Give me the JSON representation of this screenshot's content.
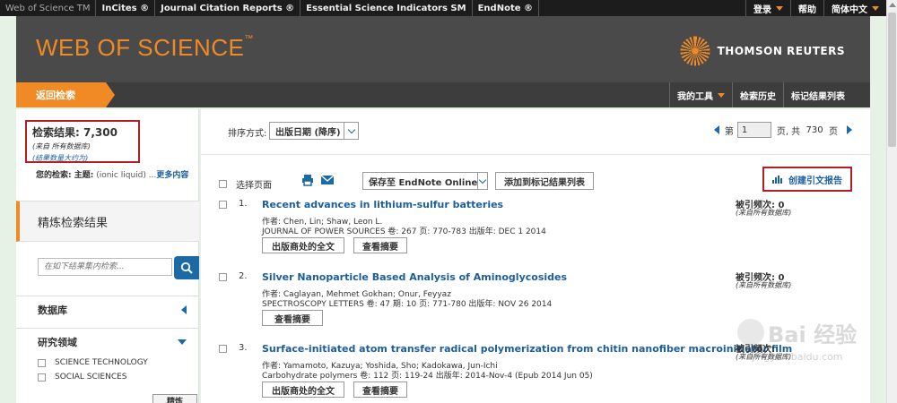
{
  "topbar": {
    "links": [
      "Web of Science TM",
      "InCites ®",
      "Journal Citation Reports ®",
      "Essential Science Indicators SM",
      "EndNote ®"
    ],
    "login": "登录",
    "help": "帮助",
    "language": "简体中文"
  },
  "brand": {
    "logo": "WEB OF SCIENCE",
    "logo_tm": "™",
    "publisher": "THOMSON REUTERS"
  },
  "nav": {
    "back": "返回检索",
    "my_tools": "我的工具",
    "search_history": "检索历史",
    "marked_list": "标记结果列表"
  },
  "sidebar": {
    "results_count": "检索结果: 7,300",
    "from_all": "(来自 所有数据库)",
    "approx": "(结果数量大约为)",
    "query_label": "您的检索: 主题:",
    "query_value": " (ionic liquid) ...",
    "more": "更多内容",
    "refine_title": "精炼检索结果",
    "search_placeholder": "在如下结果集内检索...",
    "database_title": "数据库",
    "research_area_title": "研究领域",
    "facets": [
      "SCIENCE TECHNOLOGY",
      "SOCIAL SCIENCES"
    ],
    "refine_button": "精炼"
  },
  "main": {
    "sort_label": "排序方式:",
    "sort_value": "出版日期 (降序)",
    "pager": {
      "page_label": "第",
      "current": "1",
      "page_suffix": "页, 共",
      "total": "730",
      "pages_unit": "页"
    },
    "select_page": "选择页面",
    "endnote_select": "保存至 EndNote Online",
    "add_marked": "添加到标记结果列表",
    "cite_report": "创建引文报告",
    "records": [
      {
        "num": "1.",
        "title": "Recent advances in lithium-sulfur batteries",
        "authors": "作者: Chen, Lin; Shaw, Leon L.",
        "source": "JOURNAL OF POWER SOURCES  卷: 267  页: 770-783  出版年: DEC 1 2014",
        "btn_fulltext": "出版商处的全文",
        "btn_abstract": "查看摘要",
        "cited": "被引频次: 0",
        "cited_sub": "(来自所有数据库)"
      },
      {
        "num": "2.",
        "title": "Silver Nanoparticle Based Analysis of Aminoglycosides",
        "authors": "作者: Caglayan, Mehmet Gokhan; Onur, Feyyaz",
        "source": "SPECTROSCOPY LETTERS  卷: 47  期: 10  页: 771-780  出版年: NOV 26 2014",
        "btn_abstract": "查看摘要",
        "cited": "被引频次: 0",
        "cited_sub": "(来自所有数据库)"
      },
      {
        "num": "3.",
        "title": "Surface-initiated atom transfer radical polymerization from chitin nanofiber macroinitiator film",
        "authors": "作者: Yamamoto, Kazuya; Yoshida, Sho; Kadokawa, Jun-Ichi",
        "source": "Carbohydrate polymers  卷: 112  页: 119-24  出版年: 2014-Nov-4 (Epub 2014 Jun 05)",
        "btn_fulltext": "出版商处的全文",
        "btn_abstract": "查看摘要",
        "cited": "被引频次:",
        "cited_sub": "(来自所有数据库)"
      }
    ]
  },
  "watermark": {
    "text": "Bai 经验",
    "sub": "jingyan.baidu.com"
  },
  "colors": {
    "accent": "#f08a24",
    "link": "#1a5e9e",
    "highlight_box": "#b21f24"
  }
}
